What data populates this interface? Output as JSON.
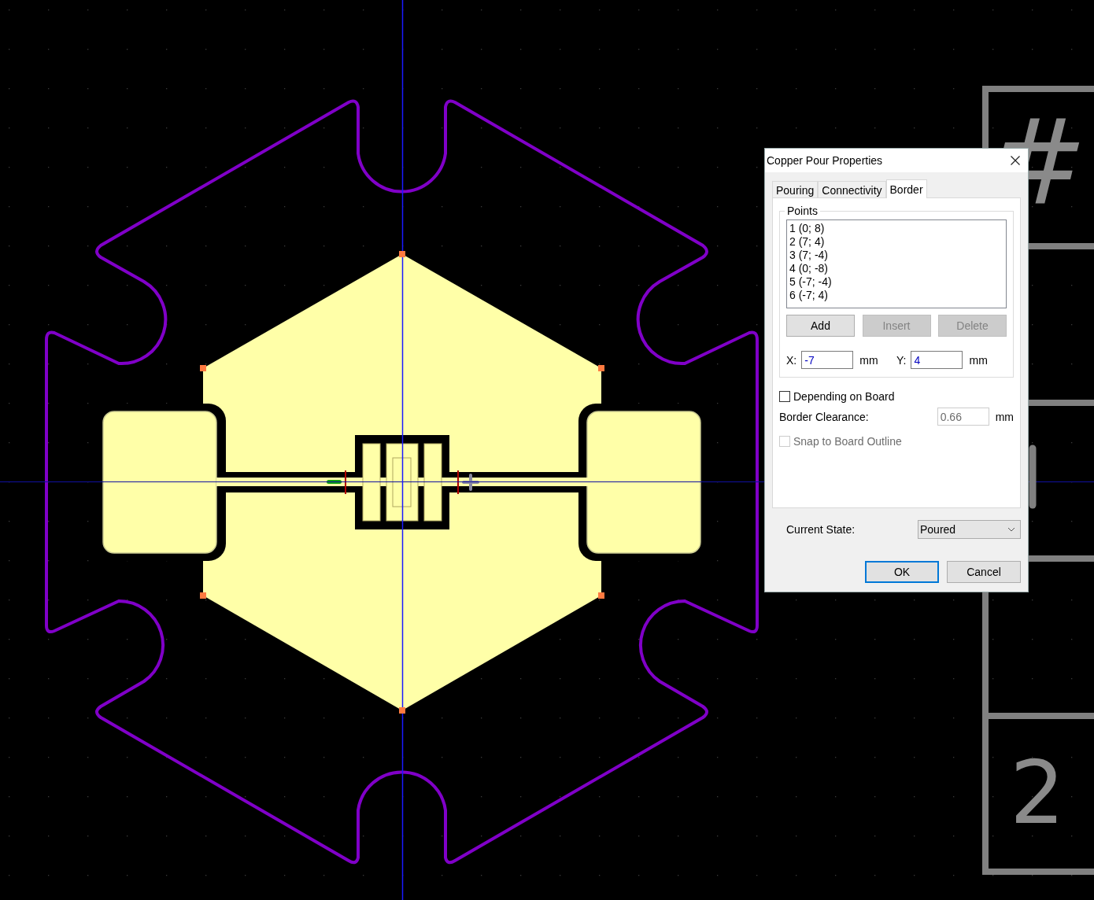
{
  "canvas": {
    "silkscreen_labels": [
      {
        "text": "#"
      },
      {
        "text": "2"
      }
    ]
  },
  "dialog": {
    "title": "Copper Pour Properties",
    "tabs": [
      {
        "label": "Pouring",
        "selected": false
      },
      {
        "label": "Connectivity",
        "selected": false
      },
      {
        "label": "Border",
        "selected": true
      }
    ],
    "points": {
      "title": "Points",
      "items": [
        {
          "text": "1 (0; 8)",
          "selected": false
        },
        {
          "text": "2 (7; 4)",
          "selected": false
        },
        {
          "text": "3 (7; -4)",
          "selected": false
        },
        {
          "text": "4 (0; -8)",
          "selected": false
        },
        {
          "text": "5 (-7; -4)",
          "selected": false
        },
        {
          "text": "6 (-7; 4)",
          "selected": false
        }
      ],
      "buttons": [
        {
          "label": "Add",
          "disabled": false
        },
        {
          "label": "Insert",
          "disabled": true
        },
        {
          "label": "Delete",
          "disabled": true
        }
      ],
      "fields": [
        {
          "label": "X:",
          "value": "-7",
          "unit": "mm"
        },
        {
          "label": "Y:",
          "value": "4",
          "unit": "mm"
        }
      ]
    },
    "depending_on_board": {
      "label": "Depending on Board",
      "checked": false,
      "disabled": false
    },
    "border_clearance": {
      "label": "Border Clearance:",
      "value": "0.66",
      "unit": "mm",
      "disabled": true
    },
    "snap_to_board_outline": {
      "label": "Snap to Board Outline",
      "checked": false,
      "disabled": true
    },
    "current_state": {
      "label": "Current State:",
      "value": "Poured"
    },
    "actions": [
      {
        "label": "OK",
        "default": true
      },
      {
        "label": "Cancel",
        "default": false
      }
    ]
  }
}
